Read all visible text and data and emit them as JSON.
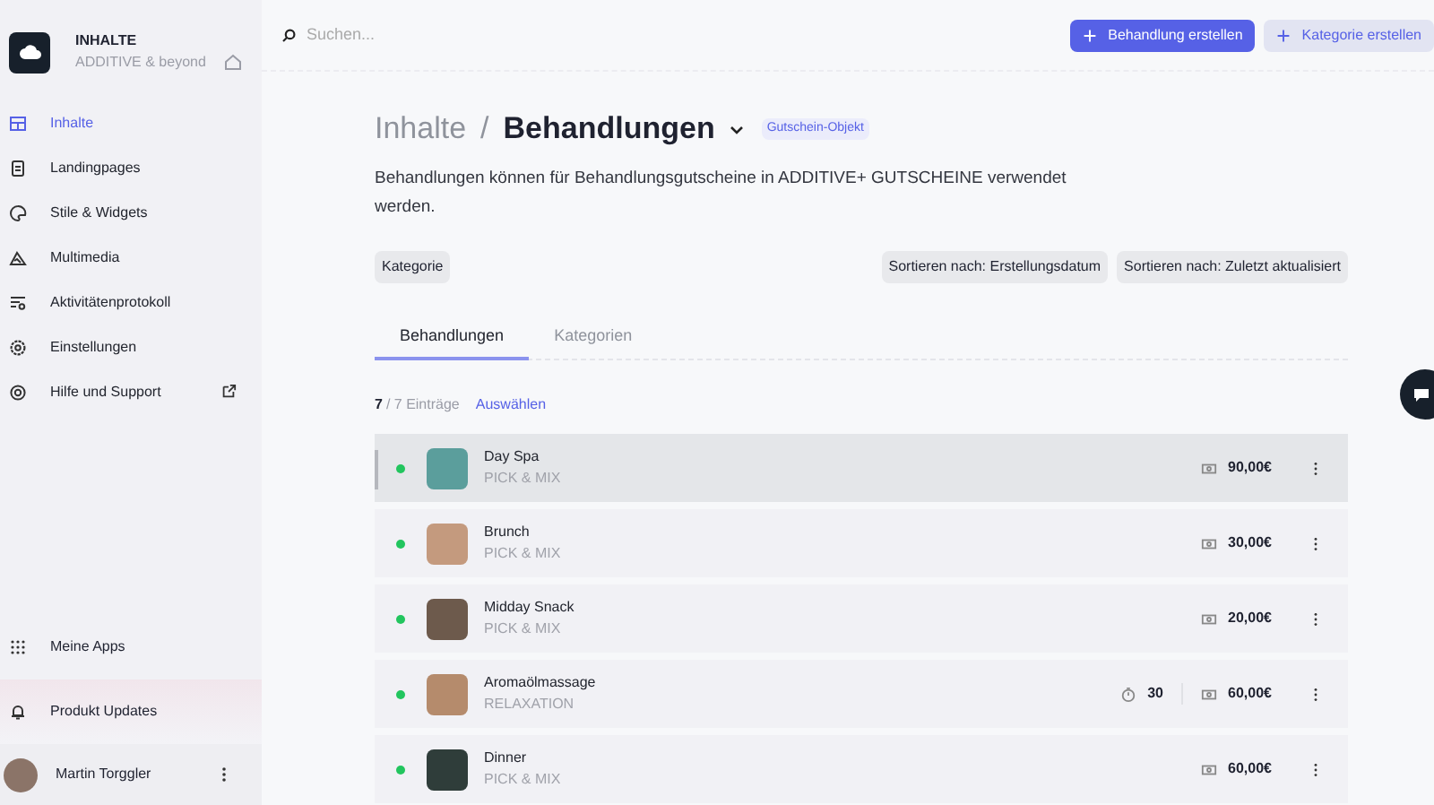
{
  "sidebar": {
    "title": "INHALTE",
    "subtitle": "ADDITIVE & beyond",
    "items": [
      {
        "label": "Inhalte",
        "kind": "layout",
        "selected": true
      },
      {
        "label": "Landingpages",
        "kind": "page",
        "selected": false
      },
      {
        "label": "Stile & Widgets",
        "kind": "palette",
        "selected": false
      },
      {
        "label": "Multimedia",
        "kind": "mountain",
        "selected": false
      },
      {
        "label": "Aktivitätenprotokoll",
        "kind": "log",
        "selected": false
      },
      {
        "label": "Einstellungen",
        "kind": "gear",
        "selected": false
      },
      {
        "label": "Hilfe und Support",
        "kind": "help",
        "selected": false,
        "external": true
      }
    ],
    "bottom_items": [
      {
        "label": "Meine Apps",
        "kind": "grid"
      },
      {
        "label": "Produkt Updates",
        "kind": "bell"
      }
    ],
    "user": {
      "name": "Martin Torggler"
    }
  },
  "topbar": {
    "search": {
      "placeholder": "Suchen..."
    },
    "buttons": [
      {
        "label": "Behandlung erstellen",
        "kind": "primary"
      },
      {
        "label": "Kategorie erstellen",
        "kind": "secondary"
      }
    ]
  },
  "breadcrumb": {
    "parent": "Inhalte",
    "separator": "/",
    "current": "Behandlungen",
    "badge": "Gutschein-Objekt"
  },
  "description": "Behandlungen können für Behandlungsgutscheine in ADDITIVE+ GUTSCHEINE verwendet werden.",
  "filters": {
    "left": [
      "Kategorie"
    ],
    "right": [
      "Sortieren nach: Erstellungsdatum",
      "Sortieren nach: Zuletzt aktualisiert"
    ]
  },
  "tabs": [
    {
      "label": "Behandlungen",
      "selected": true
    },
    {
      "label": "Kategorien",
      "selected": false
    }
  ],
  "count": {
    "shown": "7",
    "total": "/ 7 Einträge",
    "action": "Auswählen"
  },
  "rows": [
    {
      "name": "Day Spa",
      "category": "PICK & MIX",
      "price": "90,00€",
      "hovered": true,
      "active": true
    },
    {
      "name": "Brunch",
      "category": "PICK & MIX",
      "price": "30,00€",
      "hovered": false,
      "active": true
    },
    {
      "name": "Midday Snack",
      "category": "PICK & MIX",
      "price": "20,00€",
      "hovered": false,
      "active": true
    },
    {
      "name": "Aromaölmassage",
      "category": "RELAXATION",
      "duration": "30",
      "price": "60,00€",
      "hovered": false,
      "active": true
    },
    {
      "name": "Dinner",
      "category": "PICK & MIX",
      "price": "60,00€",
      "hovered": false,
      "active": true
    }
  ]
}
